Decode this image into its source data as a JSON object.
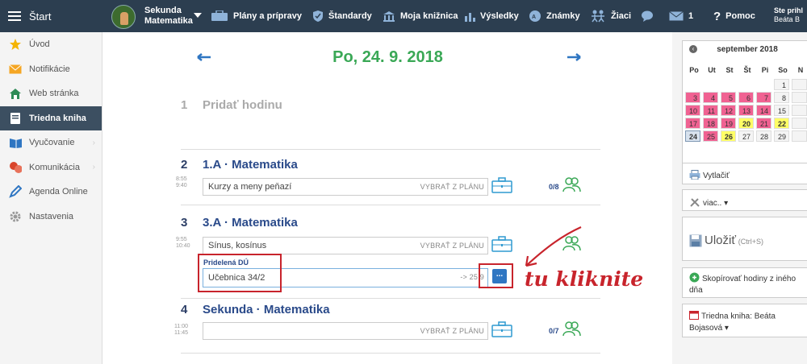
{
  "topbar": {
    "start_label": "Štart",
    "class_line1": "Sekunda",
    "class_line2": "Matematika",
    "nav": [
      {
        "label": "Plány a prípravy",
        "icon": "briefcase-icon"
      },
      {
        "label": "Štandardy",
        "icon": "shield-icon"
      },
      {
        "label": "Moja knižnica",
        "icon": "library-icon"
      },
      {
        "label": "Výsledky",
        "icon": "bar-chart-icon"
      },
      {
        "label": "Známky",
        "icon": "grade-icon"
      },
      {
        "label": "Žiaci",
        "icon": "students-icon"
      }
    ],
    "messages_count": "1",
    "help_label": "Pomoc",
    "login_line1": "Ste prihl",
    "login_line2": "Beáta B"
  },
  "sidebar": {
    "items": [
      {
        "label": "Úvod",
        "icon": "star-icon"
      },
      {
        "label": "Notifikácie",
        "icon": "envelope-icon"
      },
      {
        "label": "Web stránka",
        "icon": "home-icon"
      },
      {
        "label": "Triedna kniha",
        "icon": "book-icon"
      },
      {
        "label": "Vyučovanie",
        "icon": "open-book-icon"
      },
      {
        "label": "Komunikácia",
        "icon": "chat-icon"
      },
      {
        "label": "Agenda Online",
        "icon": "pen-icon"
      },
      {
        "label": "Nastavenia",
        "icon": "gear-icon"
      }
    ]
  },
  "main": {
    "date": "Po, 24. 9. 2018",
    "lesson1": {
      "num": "1",
      "title": "Pridať hodinu"
    },
    "lesson2": {
      "num": "2",
      "title": "1.A · Matematika",
      "time_start": "8:55",
      "time_end": "9:40",
      "topic": "Kurzy a meny peňazí",
      "plan_label": "VYBRAŤ Z PLÁNU",
      "count": "0/8"
    },
    "lesson3": {
      "num": "3",
      "title": "3.A · Matematika",
      "time_start": "9:55",
      "time_end": "10:40",
      "topic": "Sínus, kosínus",
      "plan_label": "VYBRAŤ Z PLÁNU",
      "hw_label": "Pridelená DÚ",
      "hw_value": "Učebnica 34/2",
      "hw_due": "-> 25.9"
    },
    "lesson4": {
      "num": "4",
      "title": "Sekunda · Matematika",
      "time_start": "11:00",
      "time_end": "11:45",
      "plan_label": "VYBRAŤ Z PLÁNU",
      "count": "0/7"
    },
    "dots_label": "...",
    "annotation": "tu kliknite"
  },
  "calendar": {
    "month": "september 2018",
    "weekdays": [
      "Po",
      "Ut",
      "St",
      "Št",
      "Pi",
      "So",
      "N"
    ],
    "weeks": [
      [
        "",
        "",
        "",
        "",
        "",
        "1",
        ""
      ],
      [
        "3",
        "4",
        "5",
        "6",
        "7",
        "8",
        ""
      ],
      [
        "10",
        "11",
        "12",
        "13",
        "14",
        "15",
        ""
      ],
      [
        "17",
        "18",
        "19",
        "20",
        "21",
        "22",
        ""
      ],
      [
        "24",
        "25",
        "26",
        "27",
        "28",
        "29",
        ""
      ]
    ],
    "colors": {
      "pink": "#f06292",
      "yellow": "#ffff66",
      "selected": "#d8e2ee",
      "plain": "#f4f4f4"
    }
  },
  "rpanel": {
    "print_label": "Vytlačiť",
    "more_label": "viac.. ▾",
    "save_label": "Uložiť",
    "save_hint": "(Ctrl+S)",
    "copy_line1": "Skopírovať hodiny z iného",
    "copy_line2": "dňa",
    "book_line1": "Triedna kniha: Beáta",
    "book_line2": "Bojasová ▾"
  },
  "colors": {
    "accent_green": "#3aa856",
    "nav_bg": "#2c3e50",
    "annotation_red": "#c8242c",
    "title_blue": "#2a4a8a"
  }
}
